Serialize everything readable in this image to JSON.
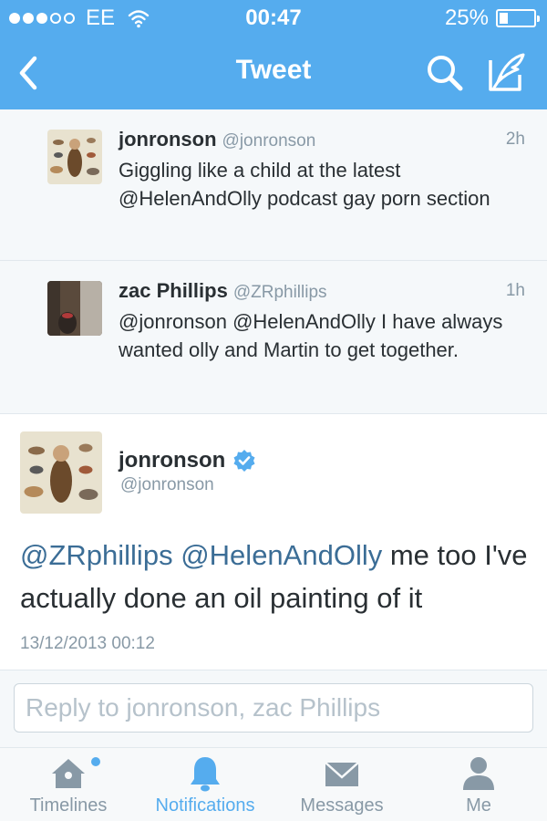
{
  "status_bar": {
    "carrier": "EE",
    "signal_bars_filled": 3,
    "signal_bars_total": 5,
    "time": "00:47",
    "battery_percent": "25%",
    "battery_level": 0.25
  },
  "navbar": {
    "title": "Tweet",
    "back_icon": "chevron-left-icon",
    "search_icon": "search-icon",
    "compose_icon": "compose-icon"
  },
  "conversation": [
    {
      "name": "jonronson",
      "handle": "@jonronson",
      "time": "2h",
      "text": "Giggling like a child at the latest @HelenAndOlly podcast gay porn section"
    },
    {
      "name": "zac Phillips",
      "handle": "@ZRphillips",
      "time": "1h",
      "text": "@jonronson @HelenAndOlly I have always wanted olly and Martin to get together."
    }
  ],
  "main_tweet": {
    "name": "jonronson",
    "handle": "@jonronson",
    "verified": true,
    "mention1": "@ZRphillips",
    "mention2": "@HelenAndOlly",
    "text_rest": " me too I've actually done an oil painting of it",
    "date": "13/12/2013 00:12"
  },
  "reply": {
    "placeholder": "Reply to jonronson, zac Phillips"
  },
  "tabbar": {
    "tabs": [
      {
        "label": "Timelines",
        "icon": "home-icon",
        "active": false,
        "has_dot": true
      },
      {
        "label": "Notifications",
        "icon": "bell-icon",
        "active": true,
        "has_dot": false
      },
      {
        "label": "Messages",
        "icon": "envelope-icon",
        "active": false,
        "has_dot": false
      },
      {
        "label": "Me",
        "icon": "person-icon",
        "active": false,
        "has_dot": false
      }
    ]
  },
  "colors": {
    "brand": "#55acee",
    "mention": "#3b6d96",
    "meta_gray": "#8899a6",
    "text": "#292f33"
  }
}
